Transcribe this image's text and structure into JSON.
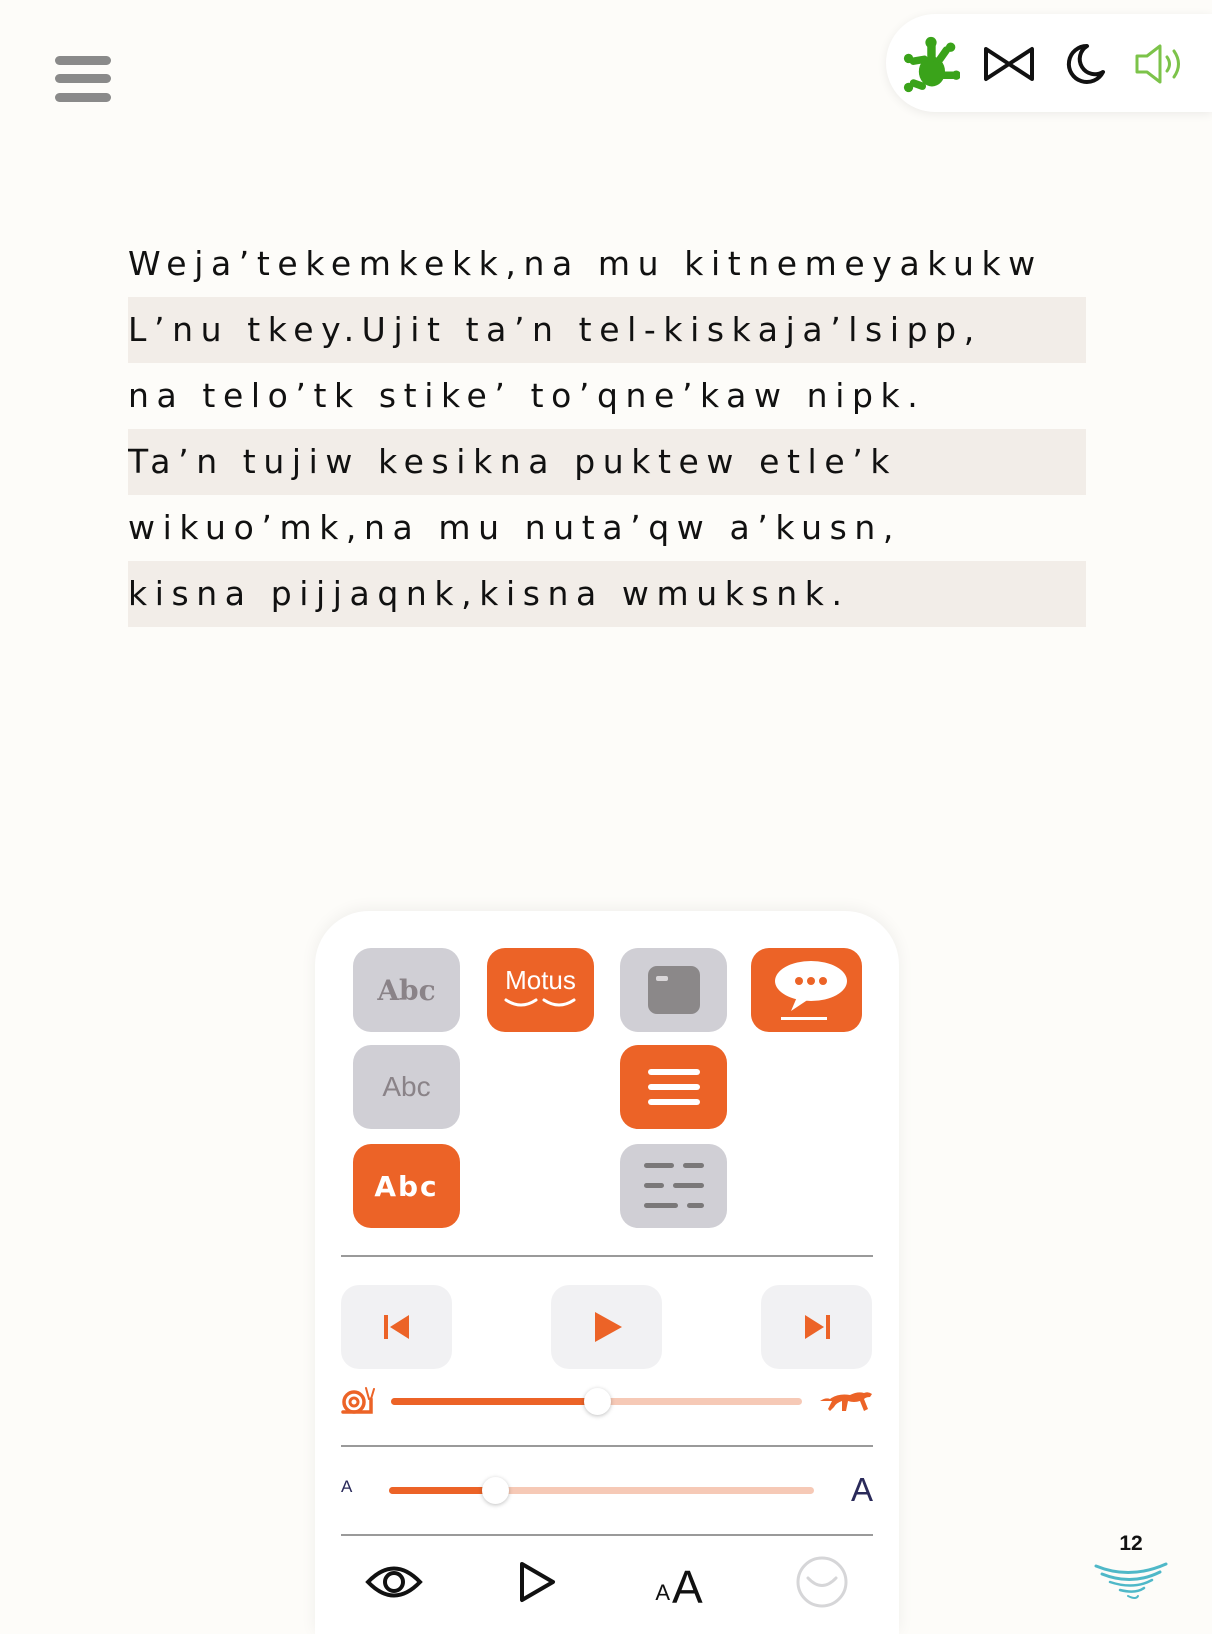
{
  "icons": {
    "menu": "hamburger-menu-icon",
    "frog": "frog-logo-icon",
    "bowtie": "bowtie-icon",
    "night": "moon-icon",
    "sound": "speaker-icon",
    "page_logo": "wave-logo-icon"
  },
  "colors": {
    "accent": "#ec6327",
    "accent_light": "#f6c9b6",
    "tile_gray": "#d0cfd5",
    "frog_green": "#3aa31a",
    "speaker_green": "#7cc34a",
    "logo_teal": "#4fb8c8",
    "line_shade": "#f2ede8"
  },
  "text_lines": [
    "Weja’tekemkekk,na mu kitnemeyakukw",
    "L’nu tkey.Ujit ta’n tel-kiskaja’lsipp,",
    "na telo’tk stike’ to’qne’kaw nipk.",
    "Ta’n tujiw kesikna puktew etle’k",
    "wikuo’mk,na mu nuta’qw a’kusn,",
    "kisna pijjaqnk,kisna wmuksnk."
  ],
  "panel": {
    "font_serif_label": "Abc",
    "font_sans_label": "Abc",
    "font_dyslexic_label": "Abc",
    "motus_label": "Motus",
    "speed_level": 0.5,
    "text_size_level": 0.25,
    "size_small_label": "A",
    "size_large_label": "A",
    "bottom_small_a": "A",
    "bottom_large_a": "A"
  },
  "page_number": "12"
}
